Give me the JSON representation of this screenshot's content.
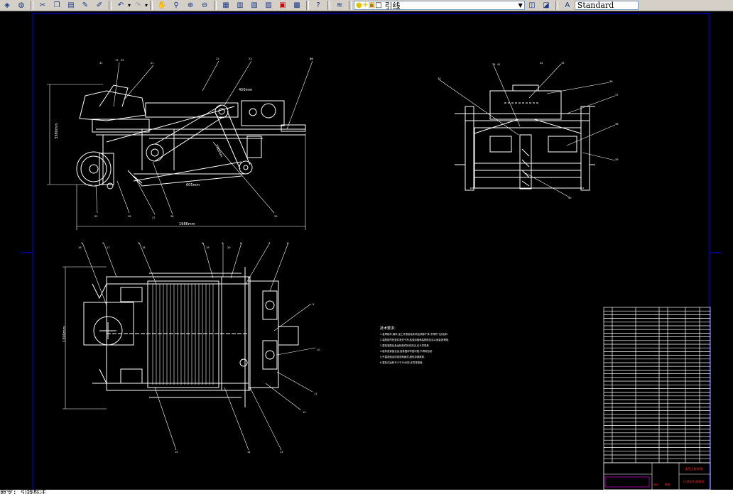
{
  "toolbar": {
    "layer_name": "引线",
    "text_style": "Standard",
    "icons": [
      "publish-icon",
      "globe-icon",
      "cut-icon",
      "copy-icon",
      "paste-icon",
      "brush-icon",
      "pencil-icon",
      "undo-icon",
      "redo-icon",
      "pan-icon",
      "zoom-realtime-icon",
      "zoom-window-icon",
      "zoom-previous-icon",
      "properties-icon",
      "design-center-icon",
      "tool-palette-icon",
      "sheet-set-icon",
      "markup-icon",
      "calculator-icon",
      "help-icon",
      "layer-manager-icon",
      "lightbulb-icon",
      "sun-icon",
      "lock-icon",
      "color-square-icon",
      "layer-state-icon",
      "layer-previous-icon",
      "text-style-icon"
    ]
  },
  "drawing": {
    "top_view": {
      "dim_width": "1986mm",
      "dim_height": "3380mm",
      "dim_top": "450mm",
      "dim_belt": "605mm",
      "dim_incline": "730mm",
      "balloons": [
        "13",
        "21",
        "22",
        "23",
        "24",
        "25",
        "26",
        "27",
        "28",
        "29",
        "30",
        "31",
        "32"
      ]
    },
    "plan_view": {
      "dim_height": "1300mm",
      "balloons": [
        "1",
        "2",
        "3",
        "4",
        "5",
        "6",
        "7",
        "8",
        "9",
        "10",
        "11",
        "12",
        "13",
        "14",
        "15",
        "16",
        "17",
        "18",
        "19",
        "20"
      ]
    },
    "side_view": {
      "balloons": [
        "33",
        "34",
        "35",
        "36",
        "37",
        "38",
        "39",
        "40",
        "41",
        "42"
      ]
    },
    "tech_requirements": {
      "title": "技术要求:",
      "lines": [
        "1.各焊接件,铸件,加工件表面毛刺均应清除干净,不得有飞边毛刺.",
        "2.装配前所有零件清洗干净,各滚动轴承装配前应涂以适量润滑脂.",
        "3.整机装配后各运转部件转动灵活,无卡滞现象.",
        "4.链条张紧度合适,各紧固件牢固可靠,不得有松动.",
        "5.外露表面涂防锈漆和面漆,颜色协调美观.",
        "6.整机试运转不少于30分钟,无异常噪音."
      ]
    },
    "title_block": {
      "school": "沈阳工程学院",
      "drawing_name": "小型花生收获机",
      "labels": [
        "设计",
        "审核",
        "比例",
        "材料"
      ]
    }
  },
  "command_line": {
    "text": "命令: 引线标注"
  }
}
